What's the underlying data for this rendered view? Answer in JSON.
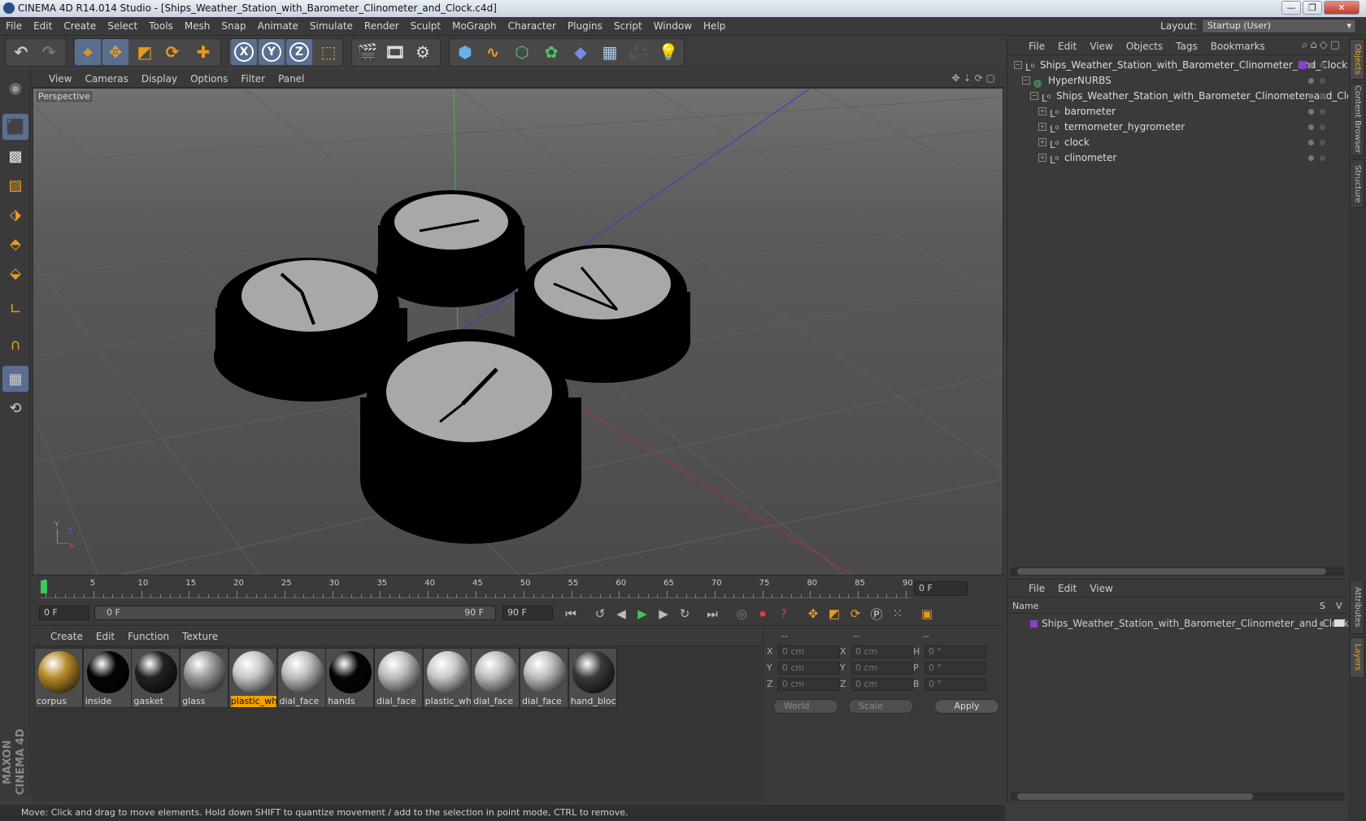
{
  "window": {
    "title": "CINEMA 4D R14.014 Studio - [Ships_Weather_Station_with_Barometer_Clinometer_and_Clock.c4d]"
  },
  "menubar": {
    "items": [
      "File",
      "Edit",
      "Create",
      "Select",
      "Tools",
      "Mesh",
      "Snap",
      "Animate",
      "Simulate",
      "Render",
      "Sculpt",
      "MoGraph",
      "Character",
      "Plugins",
      "Script",
      "Window",
      "Help"
    ],
    "layout_label": "Layout:",
    "layout_value": "Startup (User)"
  },
  "toolbar": {
    "axis_x": "X",
    "axis_y": "Y",
    "axis_z": "Z"
  },
  "viewport": {
    "menu": [
      "View",
      "Cameras",
      "Display",
      "Options",
      "Filter",
      "Panel"
    ],
    "label": "Perspective",
    "axis_y": "Y",
    "axis_z": "Z",
    "axis_x": "X"
  },
  "timeline": {
    "ticks": [
      "0",
      "5",
      "10",
      "15",
      "20",
      "25",
      "30",
      "35",
      "40",
      "45",
      "50",
      "55",
      "60",
      "65",
      "70",
      "75",
      "80",
      "85",
      "90"
    ],
    "current_frame": 0,
    "end_field": "0 F",
    "start_field": "0 F",
    "range_start": "0 F",
    "range_end": "90 F",
    "max_field": "90 F"
  },
  "materials": {
    "menu": [
      "Create",
      "Edit",
      "Function",
      "Texture"
    ],
    "items": [
      {
        "name": "corpus",
        "color": "#b58a2a"
      },
      {
        "name": "inside",
        "color": "#050505"
      },
      {
        "name": "gasket",
        "color": "#222222"
      },
      {
        "name": "glass",
        "color": "#9a9a9a"
      },
      {
        "name": "plastic_whi",
        "color": "#c8c8c8",
        "selected": true
      },
      {
        "name": "dial_face",
        "color": "#bdbdbd"
      },
      {
        "name": "hands",
        "color": "#050505"
      },
      {
        "name": "dial_face",
        "color": "#bdbdbd"
      },
      {
        "name": "plastic_whi",
        "color": "#c8c8c8"
      },
      {
        "name": "dial_face",
        "color": "#bdbdbd"
      },
      {
        "name": "dial_face",
        "color": "#bdbdbd"
      },
      {
        "name": "hand_block",
        "color": "#3a3a3a"
      }
    ]
  },
  "coords": {
    "headers": [
      "--",
      "--",
      "--"
    ],
    "rows": [
      {
        "a": "X",
        "av": "0 cm",
        "b": "X",
        "bv": "0 cm",
        "c": "H",
        "cv": "0 °"
      },
      {
        "a": "Y",
        "av": "0 cm",
        "b": "Y",
        "bv": "0 cm",
        "c": "P",
        "cv": "0 °"
      },
      {
        "a": "Z",
        "av": "0 cm",
        "b": "Z",
        "bv": "0 cm",
        "c": "B",
        "cv": "0 °"
      }
    ],
    "world": "World",
    "scale": "Scale",
    "apply": "Apply"
  },
  "objects": {
    "menu": [
      "File",
      "Edit",
      "View",
      "Objects",
      "Tags",
      "Bookmarks"
    ],
    "tree": [
      {
        "name": "Ships_Weather_Station_with_Barometer_Clinometer_and_Clock",
        "depth": 0,
        "icon": "null-icon"
      },
      {
        "name": "HyperNURBS",
        "depth": 1,
        "icon": "hypernurbs-icon"
      },
      {
        "name": "Ships_Weather_Station_with_Barometer_Clinometer_and_Clock",
        "depth": 2,
        "icon": "null-icon"
      },
      {
        "name": "barometer",
        "depth": 3,
        "icon": "null-icon"
      },
      {
        "name": "termometer_hygrometer",
        "depth": 3,
        "icon": "null-icon"
      },
      {
        "name": "clock",
        "depth": 3,
        "icon": "null-icon"
      },
      {
        "name": "clinometer",
        "depth": 3,
        "icon": "null-icon"
      }
    ]
  },
  "layers": {
    "menu": [
      "File",
      "Edit",
      "View"
    ],
    "col_name": "Name",
    "col_s": "S",
    "col_v": "V",
    "row": "Ships_Weather_Station_with_Barometer_Clinometer_and_Clock"
  },
  "sidetabs": [
    "Objects",
    "Content Browser",
    "Structure",
    "Attributes",
    "Layers"
  ],
  "brand": "MAXON CINEMA 4D",
  "status": "Move: Click and drag to move elements. Hold down SHIFT to quantize movement / add to the selection in point mode, CTRL to remove.",
  "colors": {
    "accent": "#e89b22",
    "selection": "#5a6e90",
    "highlight": "#f0a000"
  }
}
